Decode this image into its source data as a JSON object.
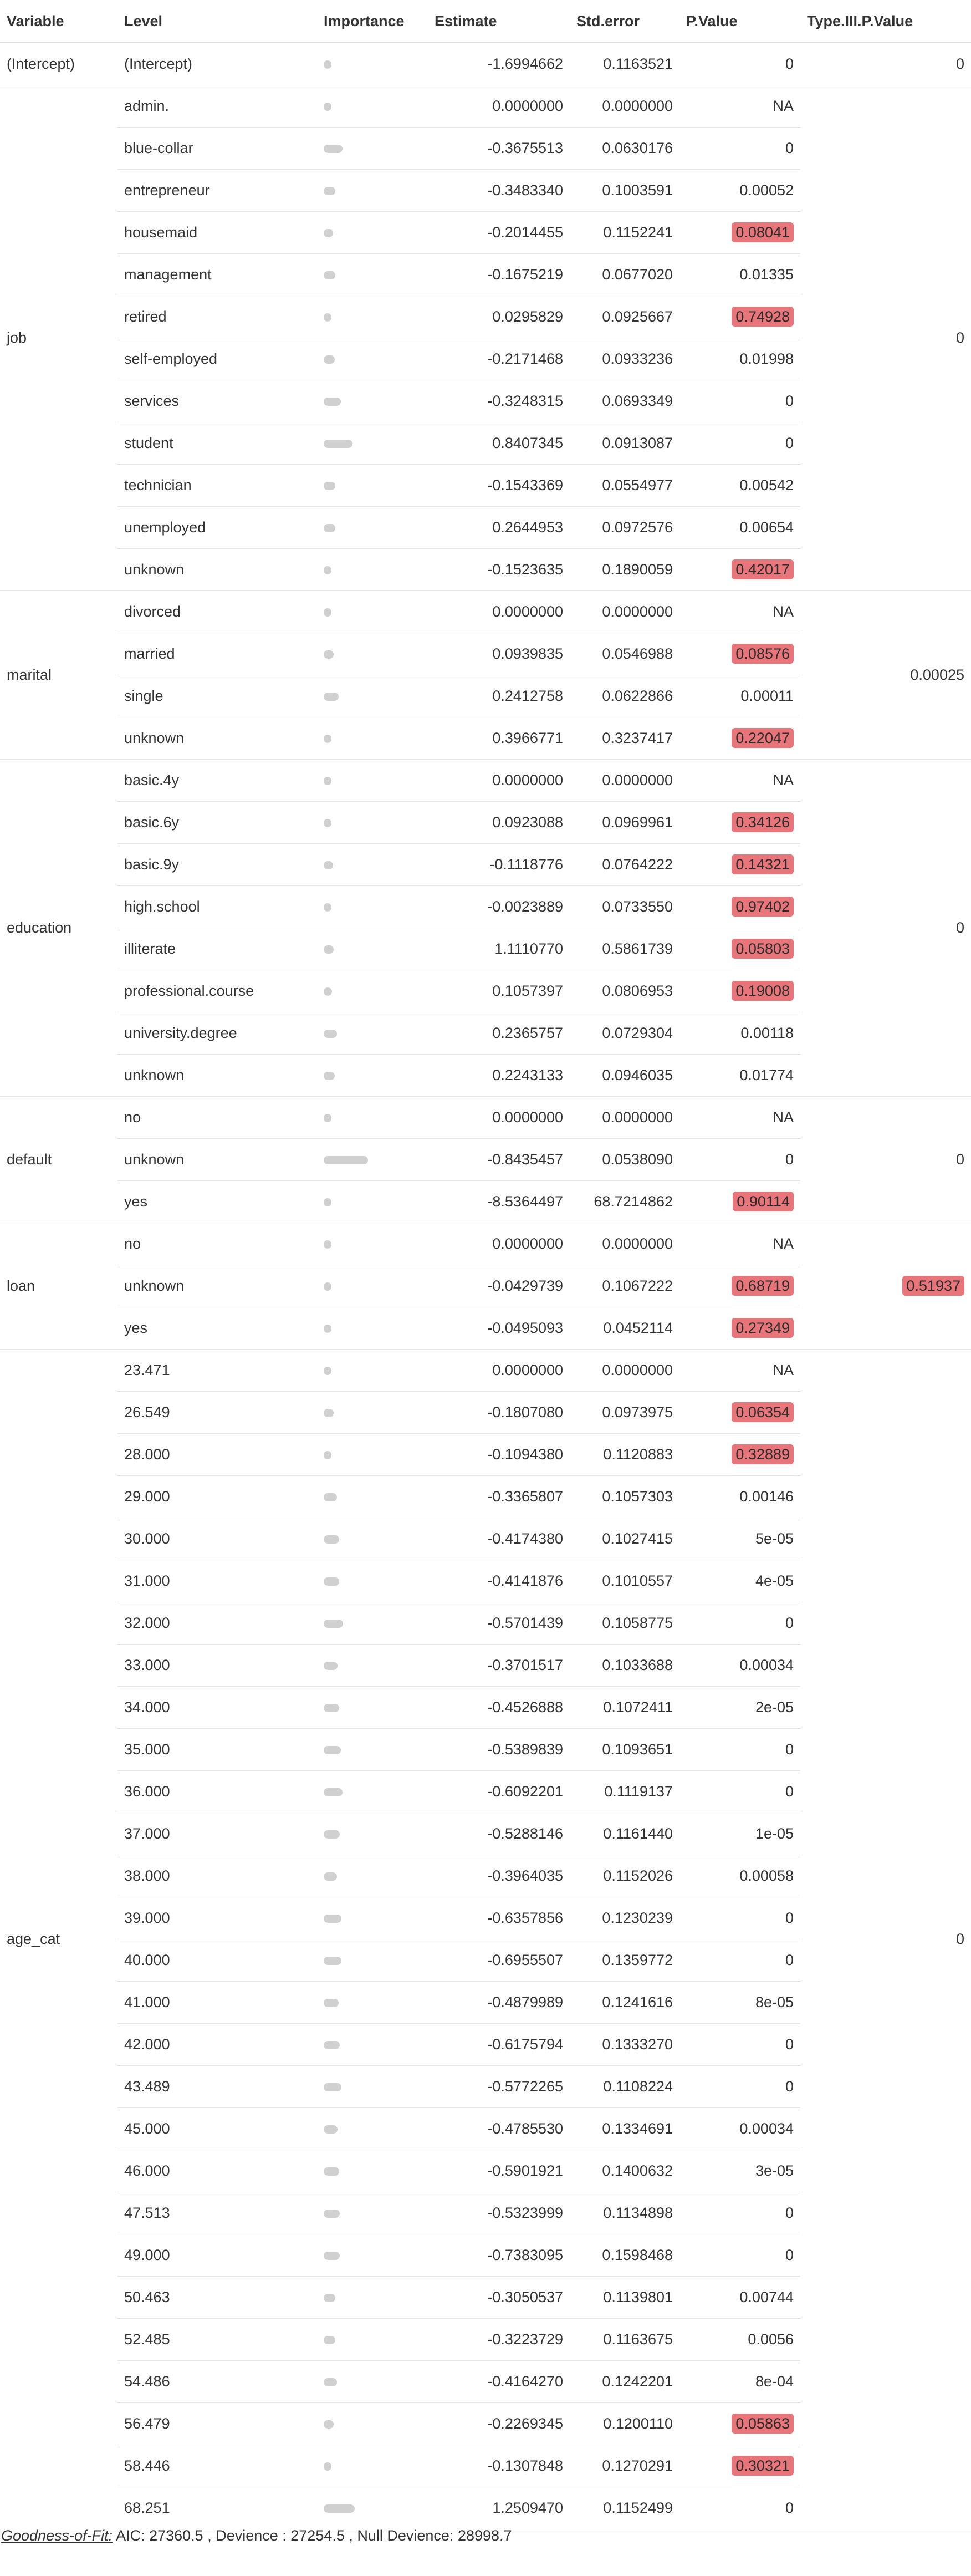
{
  "headers": {
    "variable": "Variable",
    "level": "Level",
    "importance": "Importance",
    "estimate": "Estimate",
    "std_error": "Std.error",
    "p_value": "P.Value",
    "type3_p_value": "Type.III.P.Value"
  },
  "groups": [
    {
      "variable": "(Intercept)",
      "type3": "0",
      "type3_highlight": false,
      "rows": [
        {
          "level": "(Intercept)",
          "estimate": "-1.6994662",
          "std_error": "0.1163521",
          "p_value": "0",
          "highlight": false,
          "importance": 0.08
        }
      ]
    },
    {
      "variable": "job",
      "type3": "0",
      "type3_highlight": false,
      "rows": [
        {
          "level": "admin.",
          "estimate": "0.0000000",
          "std_error": "0.0000000",
          "p_value": "NA",
          "highlight": false,
          "importance": 0.07
        },
        {
          "level": "blue-collar",
          "estimate": "-0.3675513",
          "std_error": "0.0630176",
          "p_value": "0",
          "highlight": false,
          "importance": 0.24
        },
        {
          "level": "entrepreneur",
          "estimate": "-0.3483340",
          "std_error": "0.1003591",
          "p_value": "0.00052",
          "highlight": false,
          "importance": 0.15
        },
        {
          "level": "housemaid",
          "estimate": "-0.2014455",
          "std_error": "0.1152241",
          "p_value": "0.08041",
          "highlight": true,
          "importance": 0.12
        },
        {
          "level": "management",
          "estimate": "-0.1675219",
          "std_error": "0.0677020",
          "p_value": "0.01335",
          "highlight": false,
          "importance": 0.15
        },
        {
          "level": "retired",
          "estimate": "0.0295829",
          "std_error": "0.0925667",
          "p_value": "0.74928",
          "highlight": true,
          "importance": 0.07
        },
        {
          "level": "self-employed",
          "estimate": "-0.2171468",
          "std_error": "0.0933236",
          "p_value": "0.01998",
          "highlight": false,
          "importance": 0.14
        },
        {
          "level": "services",
          "estimate": "-0.3248315",
          "std_error": "0.0693349",
          "p_value": "0",
          "highlight": false,
          "importance": 0.22
        },
        {
          "level": "student",
          "estimate": "0.8407345",
          "std_error": "0.0913087",
          "p_value": "0",
          "highlight": false,
          "importance": 0.37
        },
        {
          "level": "technician",
          "estimate": "-0.1543369",
          "std_error": "0.0554977",
          "p_value": "0.00542",
          "highlight": false,
          "importance": 0.15
        },
        {
          "level": "unemployed",
          "estimate": "0.2644953",
          "std_error": "0.0972576",
          "p_value": "0.00654",
          "highlight": false,
          "importance": 0.15
        },
        {
          "level": "unknown",
          "estimate": "-0.1523635",
          "std_error": "0.1890059",
          "p_value": "0.42017",
          "highlight": true,
          "importance": 0.1
        }
      ]
    },
    {
      "variable": "marital",
      "type3": "0.00025",
      "type3_highlight": false,
      "rows": [
        {
          "level": "divorced",
          "estimate": "0.0000000",
          "std_error": "0.0000000",
          "p_value": "NA",
          "highlight": false,
          "importance": 0.07
        },
        {
          "level": "married",
          "estimate": "0.0939835",
          "std_error": "0.0546988",
          "p_value": "0.08576",
          "highlight": true,
          "importance": 0.13
        },
        {
          "level": "single",
          "estimate": "0.2412758",
          "std_error": "0.0622866",
          "p_value": "0.00011",
          "highlight": false,
          "importance": 0.19
        },
        {
          "level": "unknown",
          "estimate": "0.3966771",
          "std_error": "0.3237417",
          "p_value": "0.22047",
          "highlight": true,
          "importance": 0.1
        }
      ]
    },
    {
      "variable": "education",
      "type3": "0",
      "type3_highlight": false,
      "rows": [
        {
          "level": "basic.4y",
          "estimate": "0.0000000",
          "std_error": "0.0000000",
          "p_value": "NA",
          "highlight": false,
          "importance": 0.07
        },
        {
          "level": "basic.6y",
          "estimate": "0.0923088",
          "std_error": "0.0969961",
          "p_value": "0.34126",
          "highlight": true,
          "importance": 0.1
        },
        {
          "level": "basic.9y",
          "estimate": "-0.1118776",
          "std_error": "0.0764222",
          "p_value": "0.14321",
          "highlight": true,
          "importance": 0.12
        },
        {
          "level": "high.school",
          "estimate": "-0.0023889",
          "std_error": "0.0733550",
          "p_value": "0.97402",
          "highlight": true,
          "importance": 0.07
        },
        {
          "level": "illiterate",
          "estimate": "1.1110770",
          "std_error": "0.5861739",
          "p_value": "0.05803",
          "highlight": true,
          "importance": 0.13
        },
        {
          "level": "professional.course",
          "estimate": "0.1057397",
          "std_error": "0.0806953",
          "p_value": "0.19008",
          "highlight": true,
          "importance": 0.11
        },
        {
          "level": "university.degree",
          "estimate": "0.2365757",
          "std_error": "0.0729304",
          "p_value": "0.00118",
          "highlight": false,
          "importance": 0.17
        },
        {
          "level": "unknown",
          "estimate": "0.2243133",
          "std_error": "0.0946035",
          "p_value": "0.01774",
          "highlight": false,
          "importance": 0.14
        }
      ]
    },
    {
      "variable": "default",
      "type3": "0",
      "type3_highlight": false,
      "rows": [
        {
          "level": "no",
          "estimate": "0.0000000",
          "std_error": "0.0000000",
          "p_value": "NA",
          "highlight": false,
          "importance": 0.07
        },
        {
          "level": "unknown",
          "estimate": "-0.8435457",
          "std_error": "0.0538090",
          "p_value": "0",
          "highlight": false,
          "importance": 0.57
        },
        {
          "level": "yes",
          "estimate": "-8.5364497",
          "std_error": "68.7214862",
          "p_value": "0.90114",
          "highlight": true,
          "importance": 0.08
        }
      ]
    },
    {
      "variable": "loan",
      "type3": "0.51937",
      "type3_highlight": true,
      "rows": [
        {
          "level": "no",
          "estimate": "0.0000000",
          "std_error": "0.0000000",
          "p_value": "NA",
          "highlight": false,
          "importance": 0.07
        },
        {
          "level": "unknown",
          "estimate": "-0.0429739",
          "std_error": "0.1067222",
          "p_value": "0.68719",
          "highlight": true,
          "importance": 0.08
        },
        {
          "level": "yes",
          "estimate": "-0.0495093",
          "std_error": "0.0452114",
          "p_value": "0.27349",
          "highlight": true,
          "importance": 0.1
        }
      ]
    },
    {
      "variable": "age_cat",
      "type3": "0",
      "type3_highlight": false,
      "rows": [
        {
          "level": "23.471",
          "estimate": "0.0000000",
          "std_error": "0.0000000",
          "p_value": "NA",
          "highlight": false,
          "importance": 0.07
        },
        {
          "level": "26.549",
          "estimate": "-0.1807080",
          "std_error": "0.0973975",
          "p_value": "0.06354",
          "highlight": true,
          "importance": 0.13
        },
        {
          "level": "28.000",
          "estimate": "-0.1094380",
          "std_error": "0.1120883",
          "p_value": "0.32889",
          "highlight": true,
          "importance": 0.1
        },
        {
          "level": "29.000",
          "estimate": "-0.3365807",
          "std_error": "0.1057303",
          "p_value": "0.00146",
          "highlight": false,
          "importance": 0.17
        },
        {
          "level": "30.000",
          "estimate": "-0.4174380",
          "std_error": "0.1027415",
          "p_value": "5e-05",
          "highlight": false,
          "importance": 0.2
        },
        {
          "level": "31.000",
          "estimate": "-0.4141876",
          "std_error": "0.1010557",
          "p_value": "4e-05",
          "highlight": false,
          "importance": 0.2
        },
        {
          "level": "32.000",
          "estimate": "-0.5701439",
          "std_error": "0.1058775",
          "p_value": "0",
          "highlight": false,
          "importance": 0.25
        },
        {
          "level": "33.000",
          "estimate": "-0.3701517",
          "std_error": "0.1033688",
          "p_value": "0.00034",
          "highlight": false,
          "importance": 0.18
        },
        {
          "level": "34.000",
          "estimate": "-0.4526888",
          "std_error": "0.1072411",
          "p_value": "2e-05",
          "highlight": false,
          "importance": 0.2
        },
        {
          "level": "35.000",
          "estimate": "-0.5389839",
          "std_error": "0.1093651",
          "p_value": "0",
          "highlight": false,
          "importance": 0.22
        },
        {
          "level": "36.000",
          "estimate": "-0.6092201",
          "std_error": "0.1119137",
          "p_value": "0",
          "highlight": false,
          "importance": 0.24
        },
        {
          "level": "37.000",
          "estimate": "-0.5288146",
          "std_error": "0.1161440",
          "p_value": "1e-05",
          "highlight": false,
          "importance": 0.21
        },
        {
          "level": "38.000",
          "estimate": "-0.3964035",
          "std_error": "0.1152026",
          "p_value": "0.00058",
          "highlight": false,
          "importance": 0.17
        },
        {
          "level": "39.000",
          "estimate": "-0.6357856",
          "std_error": "0.1230239",
          "p_value": "0",
          "highlight": false,
          "importance": 0.23
        },
        {
          "level": "40.000",
          "estimate": "-0.6955507",
          "std_error": "0.1359772",
          "p_value": "0",
          "highlight": false,
          "importance": 0.23
        },
        {
          "level": "41.000",
          "estimate": "-0.4879989",
          "std_error": "0.1241616",
          "p_value": "8e-05",
          "highlight": false,
          "importance": 0.19
        },
        {
          "level": "42.000",
          "estimate": "-0.6175794",
          "std_error": "0.1333270",
          "p_value": "0",
          "highlight": false,
          "importance": 0.21
        },
        {
          "level": "43.489",
          "estimate": "-0.5772265",
          "std_error": "0.1108224",
          "p_value": "0",
          "highlight": false,
          "importance": 0.23
        },
        {
          "level": "45.000",
          "estimate": "-0.4785530",
          "std_error": "0.1334691",
          "p_value": "0.00034",
          "highlight": false,
          "importance": 0.18
        },
        {
          "level": "46.000",
          "estimate": "-0.5901921",
          "std_error": "0.1400632",
          "p_value": "3e-05",
          "highlight": false,
          "importance": 0.2
        },
        {
          "level": "47.513",
          "estimate": "-0.5323999",
          "std_error": "0.1134898",
          "p_value": "0",
          "highlight": false,
          "importance": 0.21
        },
        {
          "level": "49.000",
          "estimate": "-0.7383095",
          "std_error": "0.1598468",
          "p_value": "0",
          "highlight": false,
          "importance": 0.21
        },
        {
          "level": "50.463",
          "estimate": "-0.3050537",
          "std_error": "0.1139801",
          "p_value": "0.00744",
          "highlight": false,
          "importance": 0.15
        },
        {
          "level": "52.485",
          "estimate": "-0.3223729",
          "std_error": "0.1163675",
          "p_value": "0.0056",
          "highlight": false,
          "importance": 0.15
        },
        {
          "level": "54.486",
          "estimate": "-0.4164270",
          "std_error": "0.1242201",
          "p_value": "8e-04",
          "highlight": false,
          "importance": 0.17
        },
        {
          "level": "56.479",
          "estimate": "-0.2269345",
          "std_error": "0.1200110",
          "p_value": "0.05863",
          "highlight": true,
          "importance": 0.13
        },
        {
          "level": "58.446",
          "estimate": "-0.1307848",
          "std_error": "0.1270291",
          "p_value": "0.30321",
          "highlight": true,
          "importance": 0.1
        },
        {
          "level": "68.251",
          "estimate": "1.2509470",
          "std_error": "0.1152499",
          "p_value": "0",
          "highlight": false,
          "importance": 0.4
        }
      ]
    }
  ],
  "goodness_of_fit": {
    "label": "Goodness-of-Fit:",
    "text": " AIC: 27360.5 , Devience : 27254.5 , Null Devience: 28998.7"
  },
  "colors": {
    "significance_highlight": "#e8757a",
    "importance_bar": "#d0d0d0",
    "row_divider": "#e3e3e3"
  }
}
